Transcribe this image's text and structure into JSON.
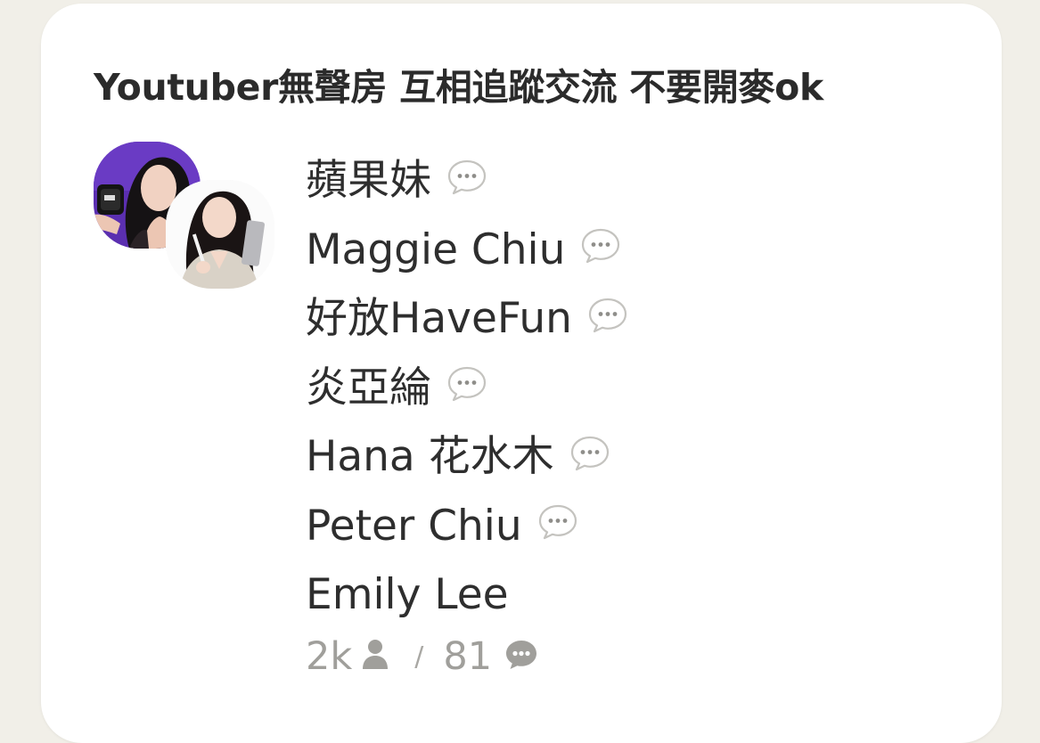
{
  "room": {
    "title": "Youtuber無聲房 互相追蹤交流 不要開麥ok"
  },
  "speakers": [
    {
      "name": "蘋果妹",
      "icon": "chat-bubble-icon"
    },
    {
      "name": "Maggie Chiu",
      "icon": "chat-bubble-icon"
    },
    {
      "name": "好放HaveFun",
      "icon": "chat-bubble-icon"
    },
    {
      "name": "炎亞綸",
      "icon": "chat-bubble-icon"
    },
    {
      "name": "Hana 花水木",
      "icon": "chat-bubble-icon"
    },
    {
      "name": "Peter Chiu",
      "icon": "chat-bubble-icon"
    },
    {
      "name": "Emily Lee",
      "icon": ""
    }
  ],
  "stats": {
    "listeners": "2k",
    "listeners_icon": "person-icon",
    "separator": "/",
    "speakers": "81",
    "speakers_icon": "chat-icon"
  },
  "colors": {
    "page_background": "#f1efe8",
    "card_background": "#ffffff",
    "text_primary": "#2e2e2e",
    "text_muted": "#a09f9b",
    "avatar_1_background": "#5b2fb0"
  }
}
